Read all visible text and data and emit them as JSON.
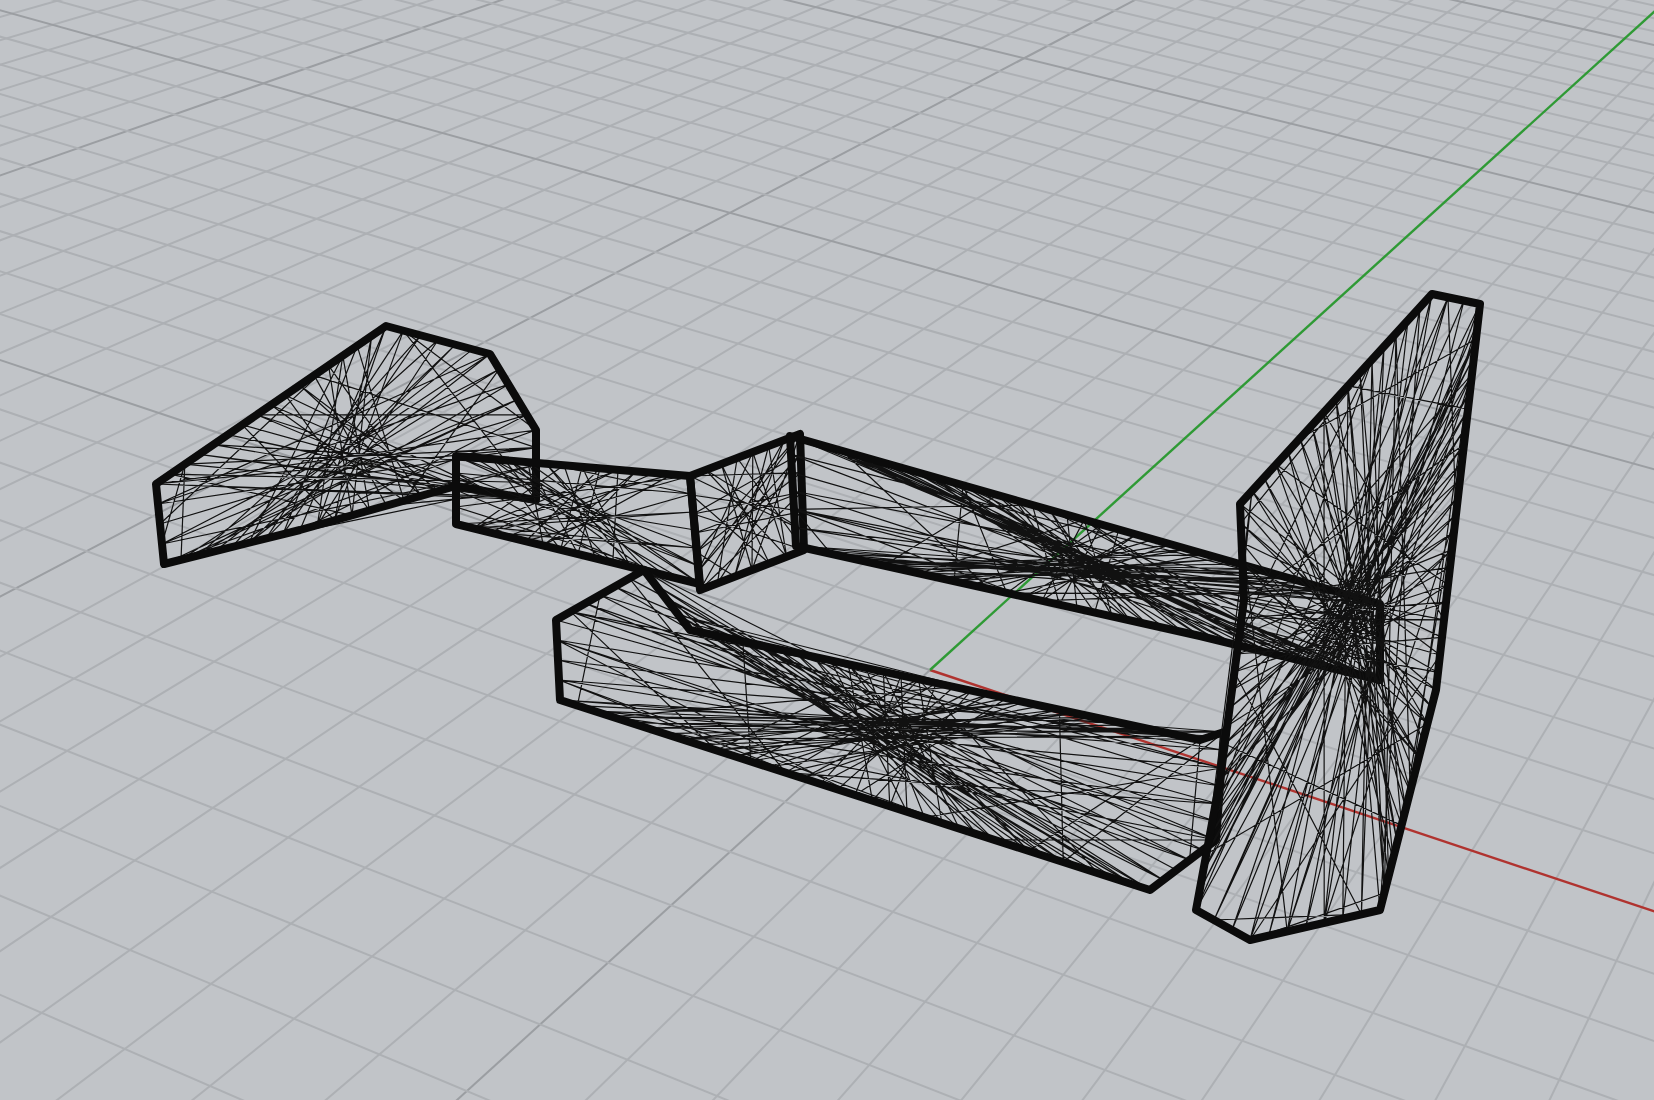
{
  "viewport": {
    "perspective": true,
    "grid": {
      "visible": true
    },
    "axes": {
      "visible": true
    },
    "model": {
      "wireframe": true
    }
  }
}
